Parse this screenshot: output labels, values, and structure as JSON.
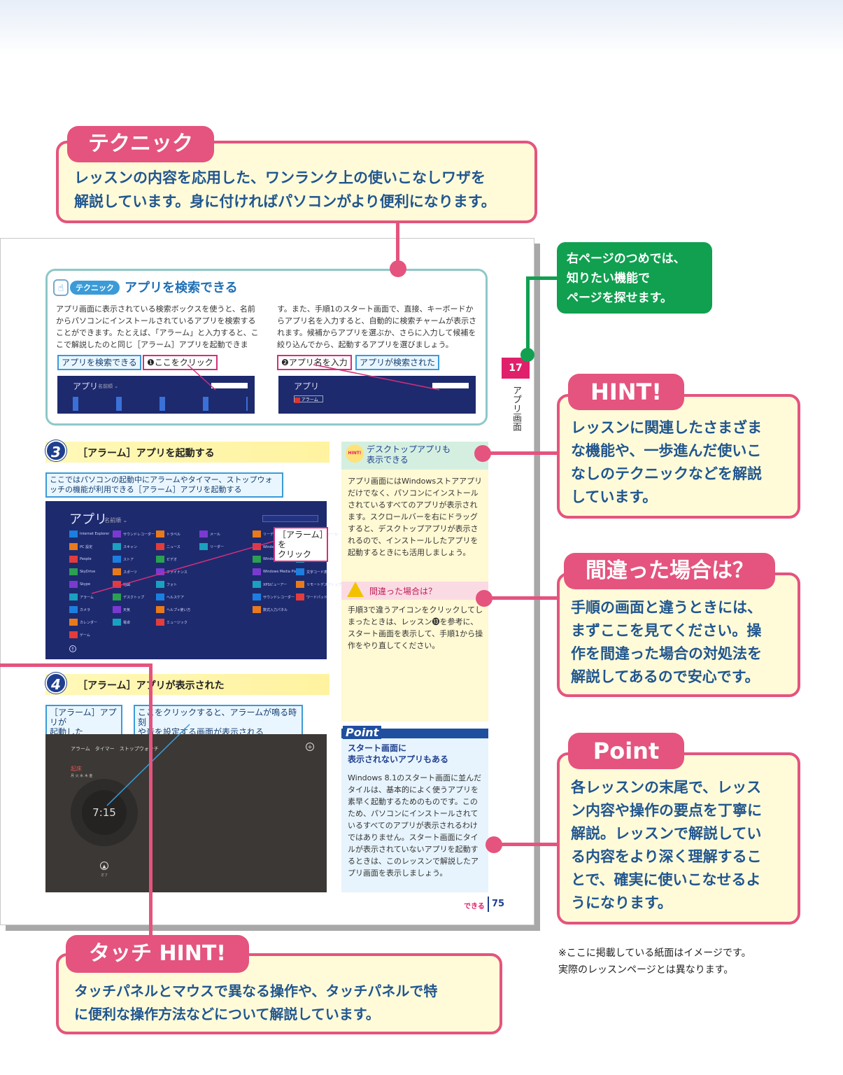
{
  "technique_callout": {
    "tab": "テクニック",
    "text": "レッスンの内容を応用した、ワンランク上の使いこなしワザを\n解説しています。身に付ければパソコンがより便利になります。"
  },
  "green_note": {
    "text": "右ページのつめでは、\n知りたい機能で\nページを探せます。"
  },
  "hint_callout": {
    "tab": "HINT!",
    "text": "レッスンに関連したさまざま\nな機能や、一歩進んだ使いこ\nなしのテクニックなどを解説\nしています。"
  },
  "mistake_callout": {
    "tab": "間違った場合は？",
    "text": "手順の画面と違うときには、\nまずここを見てください。操\n作を間違った場合の対処法を\n解説してあるので安心です。"
  },
  "point_callout": {
    "tab": "Point",
    "text": "各レッスンの末尾で、レッス\nン内容や操作の要点を丁寧に\n解説。レッスンで解説してい\nる内容をより深く理解するこ\nとで、確実に使いこなせるよ\nうになります。"
  },
  "touch_callout": {
    "tab": "タッチ HINT!",
    "text": "タッチパネルとマウスで異なる操作や、タッチパネルで特\nに便利な操作方法などについて解説しています。"
  },
  "disclaimer": "※ここに掲載している紙面はイメージです。\n実際のレッスンページとは異なります。",
  "page": {
    "technique_box": {
      "badge": "テクニック",
      "title": "アプリを検索できる",
      "col1": "アプリ画面に表示されている検索ボックスを使うと、名前からパソコンにインストールされているアプリを検索することができます。たとえば、「アラーム」と入力すると、ここで解説したのと同じ［アラーム］アプリを起動できま",
      "col2": "す。また、手順1のスタート画面で、直接、キーボードからアプリ名を入力すると、自動的に検索チャームが表示されます。候補からアプリを選ぶか、さらに入力して候補を絞り込んでから、起動するアプリを選びましょう。",
      "label1": "アプリを検索できる",
      "label2": "❶ここをクリック",
      "label3": "❷アプリ名を入力",
      "label4": "アプリが検索された",
      "shot_title": "アプリ",
      "shot_sub": "名前順 ⌄",
      "shot2_item": "アラーム"
    },
    "tab_number": "17",
    "tab_text": "アプリ画面",
    "step3": {
      "num": "3",
      "title": "［アラーム］アプリを起動する",
      "desc": "ここではパソコンの起動中にアラームやタイマー、ストップウォッチの機能が利用できる［アラーム］アプリを起動する",
      "shot_title": "アプリ",
      "shot_sub": "名前順 ⌄",
      "callout": "［アラーム］を\nクリック",
      "apps": [
        "Internet Explorer",
        "PC 設定",
        "People",
        "SkyDrive",
        "Skype",
        "アラーム",
        "カメラ",
        "カレンダー",
        "ゲーム",
        "サウンドレコーダー",
        "スキャン",
        "ストア",
        "スポーツ",
        "地図",
        "デスクトップ",
        "天気",
        "電卓",
        "トラベル",
        "ニュース",
        "ビデオ",
        "ファイナンス",
        "フォト",
        "ヘルスケア",
        "ヘルプ+使い方",
        "ミュージック",
        "メール",
        "リーダー",
        "リーディングリスト",
        "Windows FAXとスキャン",
        "Windows Journal",
        "Windows Media Player",
        "XPSビューアー",
        "サウンドレコーダー",
        "数式入力パネル",
        "ステップ記録ツール",
        "ペイント",
        "メモ帳",
        "文字コード表",
        "リモートデスクトップ接続",
        "ワードパッド"
      ]
    },
    "step4": {
      "num": "4",
      "title": "［アラーム］アプリが表示された",
      "label1": "［アラーム］アプリが\n起動した",
      "label2": "ここをクリックすると、アラームが鳴る時刻\nや音を設定する画面が表示される",
      "shot_tabs": "アラーム　タイマー　ストップウォッチ",
      "alarm_name": "起床",
      "alarm_days": "月 火 水 木 金",
      "time": "7:15",
      "off": "オフ"
    },
    "hint_box": {
      "badge": "HINT!",
      "title": "デスクトップアプリも\n表示できる",
      "body": "アプリ画面にはWindowsストアアプリだけでなく、パソコンにインストールされているすべてのアプリが表示されます。スクロールバーを右にドラッグすると、デスクトップアプリが表示されるので、インストールしたアプリを起動するときにも活用しましょう。"
    },
    "mistake_box": {
      "title": "間違った場合は？",
      "body": "手順3で違うアイコンをクリックしてしまったときは、レッスン⓭を参考に、スタート画面を表示して、手順1から操作をやり直してください。"
    },
    "point_box": {
      "badge": "Point",
      "title": "スタート画面に\n表示されないアプリもある",
      "body": "Windows 8.1のスタート画面に並んだタイルは、基本的によく使うアプリを素早く起動するためのものです。このため、パソコンにインストールされているすべてのアプリが表示されるわけではありません。スタート画面にタイルが表示されていないアプリを起動するときは、このレッスンで解説したアプリ画面を表示しましょう。"
    },
    "footer_brand": "できる",
    "page_number": "75"
  },
  "colors": {
    "pink": "#e4547e",
    "green": "#10a050",
    "navy": "#21568f"
  }
}
